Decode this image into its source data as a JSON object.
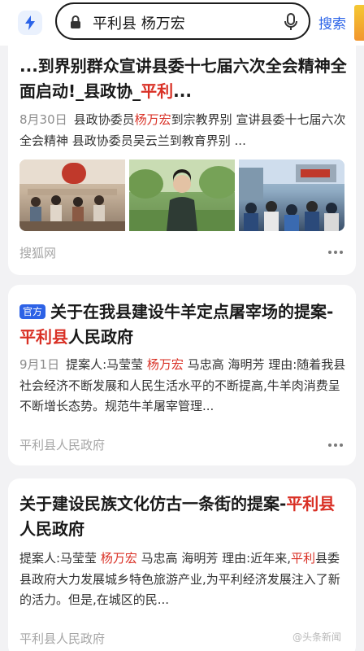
{
  "search": {
    "query": "平利县 杨万宏",
    "button_label": "搜索"
  },
  "results": [
    {
      "title_pre": "...到界别群众宣讲县委十七届六次全会精神全面启动!_县政协_",
      "title_hl": "平利",
      "title_post": "...",
      "date": "8月30日",
      "snippet_1": "县政协委员",
      "snippet_hl": "杨万宏",
      "snippet_2": "到宗教界别 宣讲县委十七届六次全会精神 县政协委员吴云兰到教育界别 ...",
      "images": [
        "meeting-room-photo",
        "woman-speaking-photo",
        "outdoor-gathering-photo"
      ],
      "source": "搜狐网"
    },
    {
      "badge": "官方",
      "title_pre": "关于在我县建设牛羊定点屠宰场的提案-",
      "title_hl": "平利县",
      "title_post": "人民政府",
      "date": "9月1日",
      "snippet_1": "提案人:马莹莹 ",
      "snippet_hl": "杨万宏",
      "snippet_2": " 马忠高 海明芳 理由:随着我县社会经济不断发展和人民生活水平的不断提高,牛羊肉消费呈不断增长态势。规范牛羊屠宰管理...",
      "source": "平利县人民政府"
    },
    {
      "title_pre": "关于建设民族文化仿古一条街的提案-",
      "title_hl": "平利县",
      "title_post": "人民政府",
      "snippet_1": "提案人:马莹莹 ",
      "snippet_hl": "杨万宏",
      "snippet_2": " 马忠高 海明芳 理由:近年来,",
      "snippet_hl2": "平利",
      "snippet_3": "县委县政府大力发展城乡特色旅游产业,为平利经济发展注入了新的活力。但是,在城区的民...",
      "source": "平利县人民政府"
    }
  ],
  "watermark": "@头条新闻"
}
